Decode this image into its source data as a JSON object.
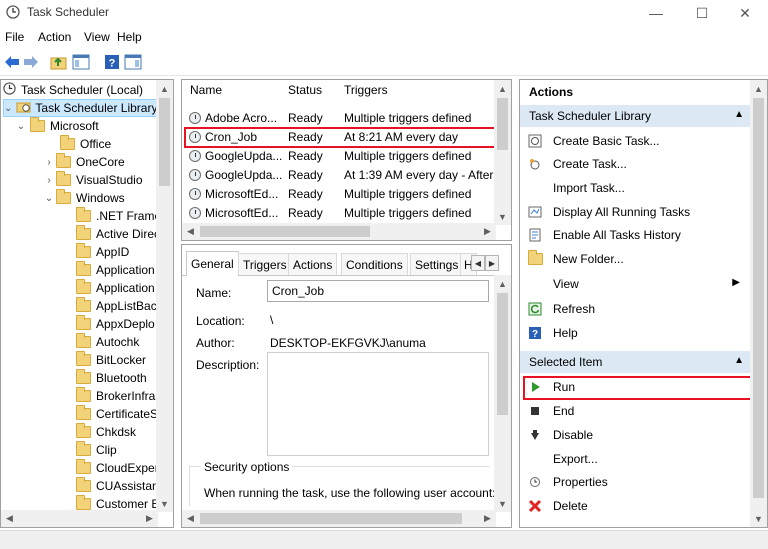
{
  "window": {
    "title": "Task Scheduler",
    "minimize": "—",
    "maximize": "☐",
    "close": "✕"
  },
  "menu": [
    "File",
    "Action",
    "View",
    "Help"
  ],
  "tree": {
    "root": "Task Scheduler (Local)",
    "library": "Task Scheduler Library",
    "microsoft": "Microsoft",
    "office": "Office",
    "onecore": "OneCore",
    "visualstudio": "VisualStudio",
    "windows": "Windows",
    "windows_children": [
      ".NET Frame",
      "Active Direc",
      "AppID",
      "Application",
      "Application",
      "AppListBac",
      "AppxDeplo",
      "Autochk",
      "BitLocker",
      "Bluetooth",
      "BrokerInfras",
      "CertificateS",
      "Chkdsk",
      "Clip",
      "CloudExper",
      "CUAssistan",
      "Customer E"
    ]
  },
  "task_list": {
    "columns": [
      "Name",
      "Status",
      "Triggers"
    ],
    "rows": [
      {
        "name": "Adobe Acro...",
        "status": "Ready",
        "trigger": "Multiple triggers defined"
      },
      {
        "name": "Cron_Job",
        "status": "Ready",
        "trigger": "At 8:21 AM every day"
      },
      {
        "name": "GoogleUpda...",
        "status": "Ready",
        "trigger": "Multiple triggers defined"
      },
      {
        "name": "GoogleUpda...",
        "status": "Ready",
        "trigger": "At 1:39 AM every day - After"
      },
      {
        "name": "MicrosoftEd...",
        "status": "Ready",
        "trigger": "Multiple triggers defined"
      },
      {
        "name": "MicrosoftEd...",
        "status": "Ready",
        "trigger": "Multiple triggers defined"
      }
    ]
  },
  "details": {
    "tabs": [
      "General",
      "Triggers",
      "Actions",
      "Conditions",
      "Settings",
      "H"
    ],
    "name_label": "Name:",
    "name_value": "Cron_Job",
    "location_label": "Location:",
    "location_value": "\\",
    "author_label": "Author:",
    "author_value": "DESKTOP-EKFGVKJ\\anuma",
    "description_label": "Description:",
    "security_label": "Security options",
    "security_text": "When running the task, use the following user account:"
  },
  "actions": {
    "title": "Actions",
    "section1": "Task Scheduler Library",
    "items1": [
      "Create Basic Task...",
      "Create Task...",
      "Import Task...",
      "Display All Running Tasks",
      "Enable All Tasks History",
      "New Folder...",
      "View",
      "Refresh",
      "Help"
    ],
    "section2": "Selected Item",
    "items2": [
      "Run",
      "End",
      "Disable",
      "Export...",
      "Properties",
      "Delete"
    ]
  },
  "colors": {
    "highlight_box": "#e81123",
    "section_header": "#dce9f5",
    "selection": "#cce8ff"
  }
}
